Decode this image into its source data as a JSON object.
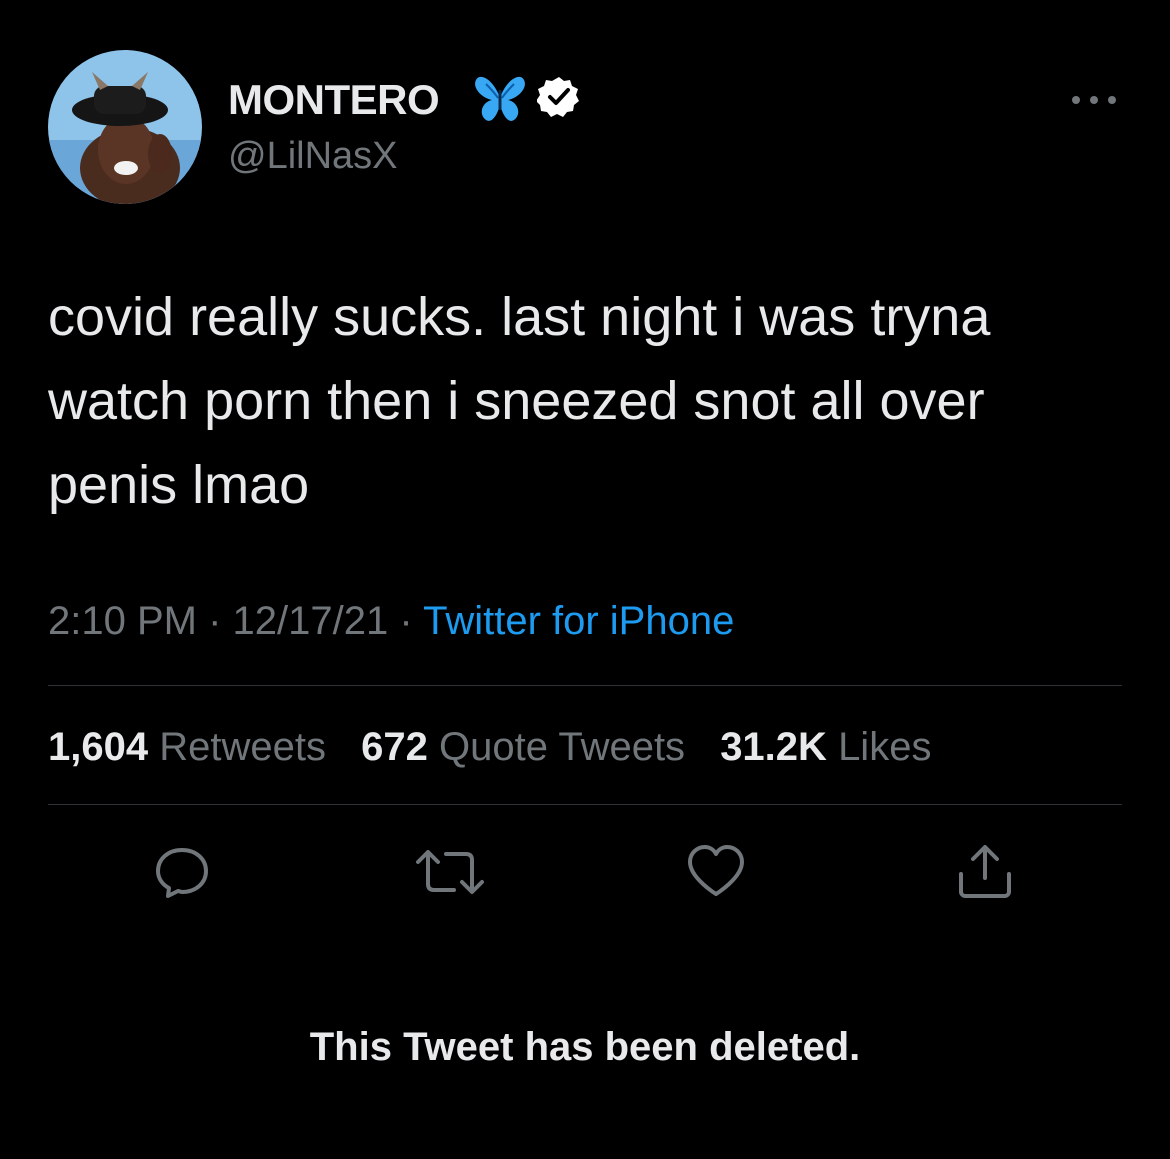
{
  "user": {
    "display_name": "MONTERO",
    "handle": "@LilNasX",
    "badge_icon": "butterfly-emoji",
    "verified_icon": "verified-badge-icon"
  },
  "tweet": {
    "text": "covid really sucks. last night i was tryna watch porn then i sneezed snot all over penis lmao",
    "time": "2:10 PM",
    "date": "12/17/21",
    "separator": "·",
    "source": "Twitter for iPhone"
  },
  "stats": {
    "retweets_count": "1,604",
    "retweets_label": "Retweets",
    "quotes_count": "672",
    "quotes_label": "Quote Tweets",
    "likes_count": "31.2K",
    "likes_label": "Likes"
  },
  "actions": [
    "reply-icon",
    "retweet-icon",
    "like-icon",
    "share-icon"
  ],
  "notice": "This Tweet has been deleted.",
  "colors": {
    "background": "#000000",
    "primary_text": "#e7e9ea",
    "secondary_text": "#71767b",
    "link": "#1d9bf0",
    "divider": "#2f3336"
  }
}
